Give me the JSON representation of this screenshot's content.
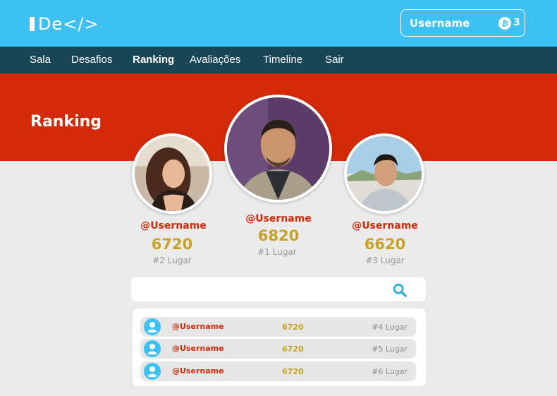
{
  "app": {
    "logo_text": "De</>"
  },
  "header": {
    "username": "Username",
    "coin_symbol": "₿",
    "coins": "3"
  },
  "nav": {
    "items": [
      {
        "label": "Sala"
      },
      {
        "label": "Desafios"
      },
      {
        "label": "Ranking",
        "active": true
      },
      {
        "label": "Avaliações"
      },
      {
        "label": "Timeline"
      },
      {
        "label": "Sair"
      }
    ]
  },
  "banner": {
    "title": "Ranking"
  },
  "podium": {
    "first": {
      "username": "@Username",
      "score": "6820",
      "place": "#1 Lugar"
    },
    "second": {
      "username": "@Username",
      "score": "6720",
      "place": "#2 Lugar"
    },
    "third": {
      "username": "@Username",
      "score": "6620",
      "place": "#3 Lugar"
    }
  },
  "search": {
    "placeholder": "",
    "value": ""
  },
  "ranking_list": [
    {
      "username": "@Username",
      "score": "6720",
      "place": "#4 Lugar"
    },
    {
      "username": "@Username",
      "score": "6720",
      "place": "#5 Lugar"
    },
    {
      "username": "@Username",
      "score": "6720",
      "place": "#6 Lugar"
    }
  ],
  "colors": {
    "header": "#3dc1f2",
    "nav": "#1a4555",
    "banner": "#d42a07",
    "score": "#c8a227",
    "background": "#ebebeb"
  },
  "icons": [
    "logo-icon",
    "coin-icon",
    "search-icon",
    "user-avatar-icon"
  ]
}
